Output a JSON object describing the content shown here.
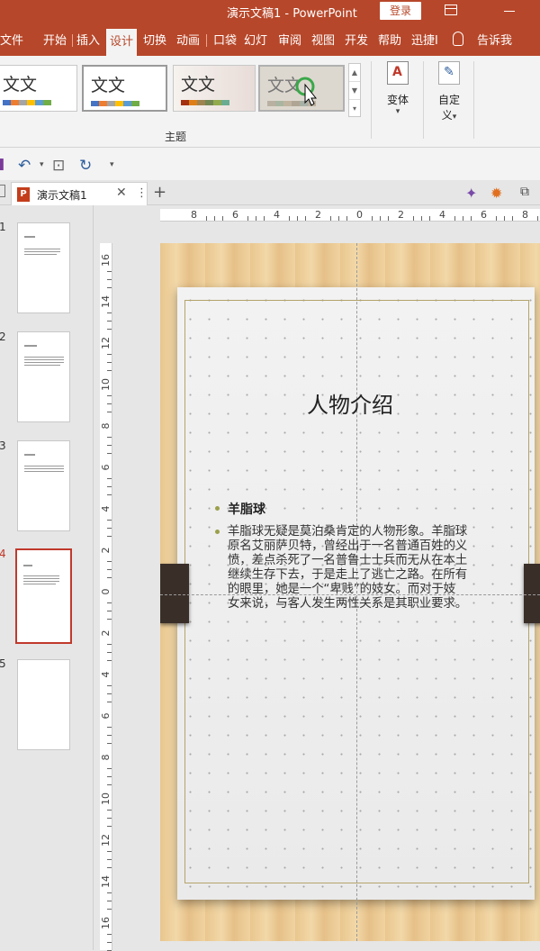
{
  "window": {
    "title": "演示文稿1  -  PowerPoint",
    "login_label": "登录"
  },
  "menu": {
    "tabs": [
      "文件",
      "开始",
      "插入",
      "设计",
      "切换",
      "动画",
      "口袋",
      "幻灯",
      "审阅",
      "视图",
      "开发",
      "帮助",
      "迅捷I"
    ],
    "active_index": 3,
    "tell_me": "告诉我",
    "colors": {
      "accent": "#b7472a",
      "ribbon_bg": "#f3f3f3"
    }
  },
  "ribbon": {
    "themes": [
      {
        "text": "文文",
        "style": "plain"
      },
      {
        "text": "文文",
        "style": "selected"
      },
      {
        "text": "文文",
        "style": "textured"
      },
      {
        "text": "文文",
        "style": "hover"
      }
    ],
    "group_label": "主题",
    "variants_label": "变体",
    "custom_label_1": "自定",
    "custom_label_2": "义"
  },
  "document_tab": {
    "name": "演示文稿1"
  },
  "thumbnails": [
    {
      "number": "1"
    },
    {
      "number": "2"
    },
    {
      "number": "3"
    },
    {
      "number": "4",
      "active": true
    },
    {
      "number": "5"
    }
  ],
  "ruler": {
    "horizontal": [
      "8",
      "6",
      "4",
      "2",
      "0",
      "2",
      "4",
      "6",
      "8"
    ],
    "vertical": [
      "16",
      "14",
      "12",
      "10",
      "8",
      "6",
      "4",
      "2",
      "0",
      "2",
      "4",
      "6",
      "8",
      "10",
      "12",
      "14",
      "16"
    ]
  },
  "slide": {
    "title": "人物介绍",
    "bullet_heading": "羊脂球",
    "bullet_lines": [
      "羊脂球无疑是莫泊桑肯定的人物形象。羊脂球",
      "原名艾丽萨贝特，曾经出于一名普通百姓的义",
      "愤，差点杀死了一名普鲁士士兵而无从在本土",
      "继续生存下去，于是走上了逃亡之路。在所有",
      "的眼里，她是一个“卑贱”的妓女。而对于妓",
      "女来说，与客人发生两性关系是其职业要求。"
    ]
  }
}
